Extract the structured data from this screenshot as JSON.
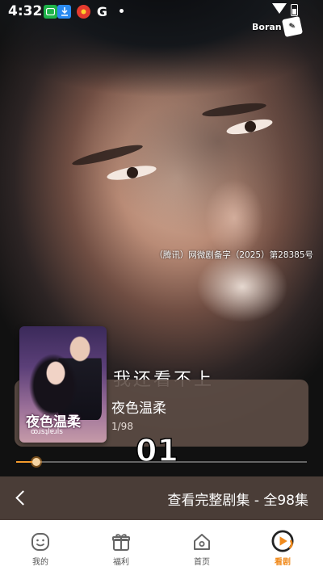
{
  "status_bar": {
    "time": "4:32",
    "icons": [
      "chat-app-icon",
      "download-icon",
      "news-app-icon",
      "google-icon",
      "notification-dot"
    ],
    "google_glyph": "G"
  },
  "watermark": {
    "text": "Boran"
  },
  "video": {
    "license_text": "（腾讯）网微剧备字（2025）第28385号",
    "subtitle_partial": "我还看不上",
    "episode_number": "01",
    "progress_fraction": 0.07
  },
  "drama_card": {
    "title": "夜色温柔",
    "episode_count": "1/98",
    "poster_title": "夜色温柔",
    "poster_subtitle": "ꝏɹsʇlɐɹls"
  },
  "episodes_bar": {
    "text": "查看完整剧集 - 全98集"
  },
  "tabbar": {
    "tabs": [
      {
        "label": "我的",
        "icon": "smile-face-icon",
        "active": false
      },
      {
        "label": "福利",
        "icon": "gift-icon",
        "active": false
      },
      {
        "label": "首页",
        "icon": "home-icon",
        "active": false
      },
      {
        "label": "看剧",
        "icon": "play-circle-icon",
        "active": true
      }
    ]
  },
  "colors": {
    "accent": "#f08a1c",
    "card_bg": "#5e4e46",
    "episodes_bar_bg": "#4a3d37"
  }
}
